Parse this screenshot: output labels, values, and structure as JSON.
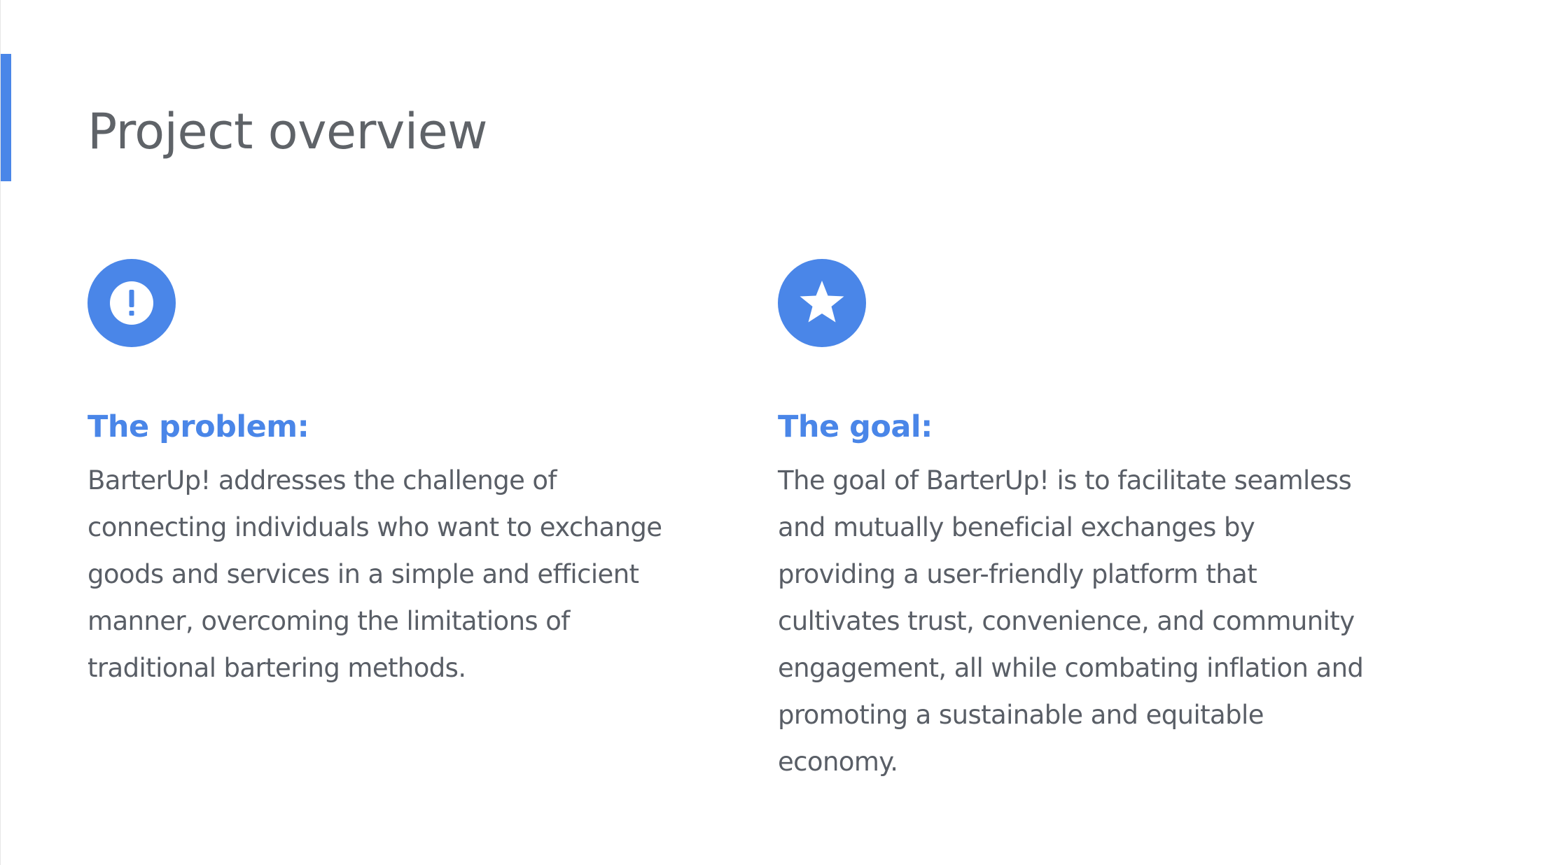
{
  "colors": {
    "accent": "#4A86E8",
    "title_text": "#5F6368",
    "body_text": "#595E66",
    "background": "#FFFFFF"
  },
  "page": {
    "title": "Project overview"
  },
  "sections": {
    "problem": {
      "icon": "exclamation-icon",
      "heading": "The problem:",
      "body_lines": [
        "BarterUp! addresses the challenge of",
        "connecting individuals who want to exchange",
        "goods and services in a simple and efficient",
        "manner, overcoming the limitations of",
        "traditional bartering methods."
      ]
    },
    "goal": {
      "icon": "star-icon",
      "heading": "The goal:",
      "body_lines": [
        "The goal of BarterUp! is to facilitate seamless",
        "and mutually beneficial exchanges by",
        "providing a user-friendly platform that",
        "cultivates trust, convenience, and community",
        "engagement, all while combating inflation and",
        "promoting a sustainable and equitable",
        "economy."
      ]
    }
  }
}
